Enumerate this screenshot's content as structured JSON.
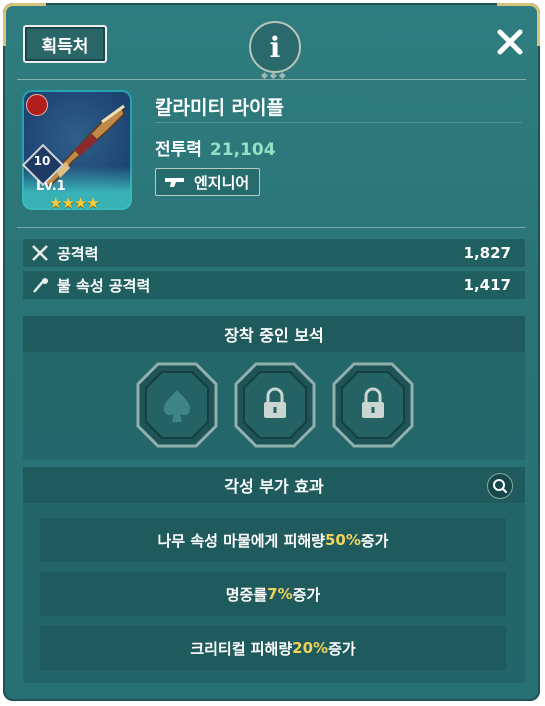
{
  "header": {
    "source_button": "획득처",
    "info_icon": "info-icon",
    "close_icon": "close-icon"
  },
  "item": {
    "name": "칼라미티 라이플",
    "power_label": "전투력",
    "power_value": "21,104",
    "class_label": "엔지니어",
    "level_number": "10",
    "level_text": "Lv.1",
    "stars": "★★★★",
    "element_icon": "fire-element-icon"
  },
  "stats": [
    {
      "label": "공격력",
      "value": "1,827",
      "icon": "crossed-swords-icon"
    },
    {
      "label": "불 속성 공격력",
      "value": "1,417",
      "icon": "fire-sword-icon"
    }
  ],
  "gems": {
    "title": "장착 중인 보석",
    "slots": [
      {
        "state": "empty",
        "icon": "spade-icon"
      },
      {
        "state": "locked",
        "icon": "lock-icon"
      },
      {
        "state": "locked",
        "icon": "lock-icon"
      }
    ]
  },
  "awakening": {
    "title": "각성 부가 효과",
    "effects": [
      {
        "prefix": "나무 속성 마물에게 피해량 ",
        "highlight": "50%",
        "suffix": " 증가"
      },
      {
        "prefix": "명중률 ",
        "highlight": "7%",
        "suffix": " 증가"
      },
      {
        "prefix": "크리티컬 피해량 ",
        "highlight": "20%",
        "suffix": " 증가"
      }
    ]
  },
  "colors": {
    "panel": "#2f7d80",
    "accent_green": "#8fe3c4",
    "highlight_yellow": "#f0d35a",
    "star_gold": "#f5cc3c",
    "gold_trim": "#d9c37a"
  }
}
